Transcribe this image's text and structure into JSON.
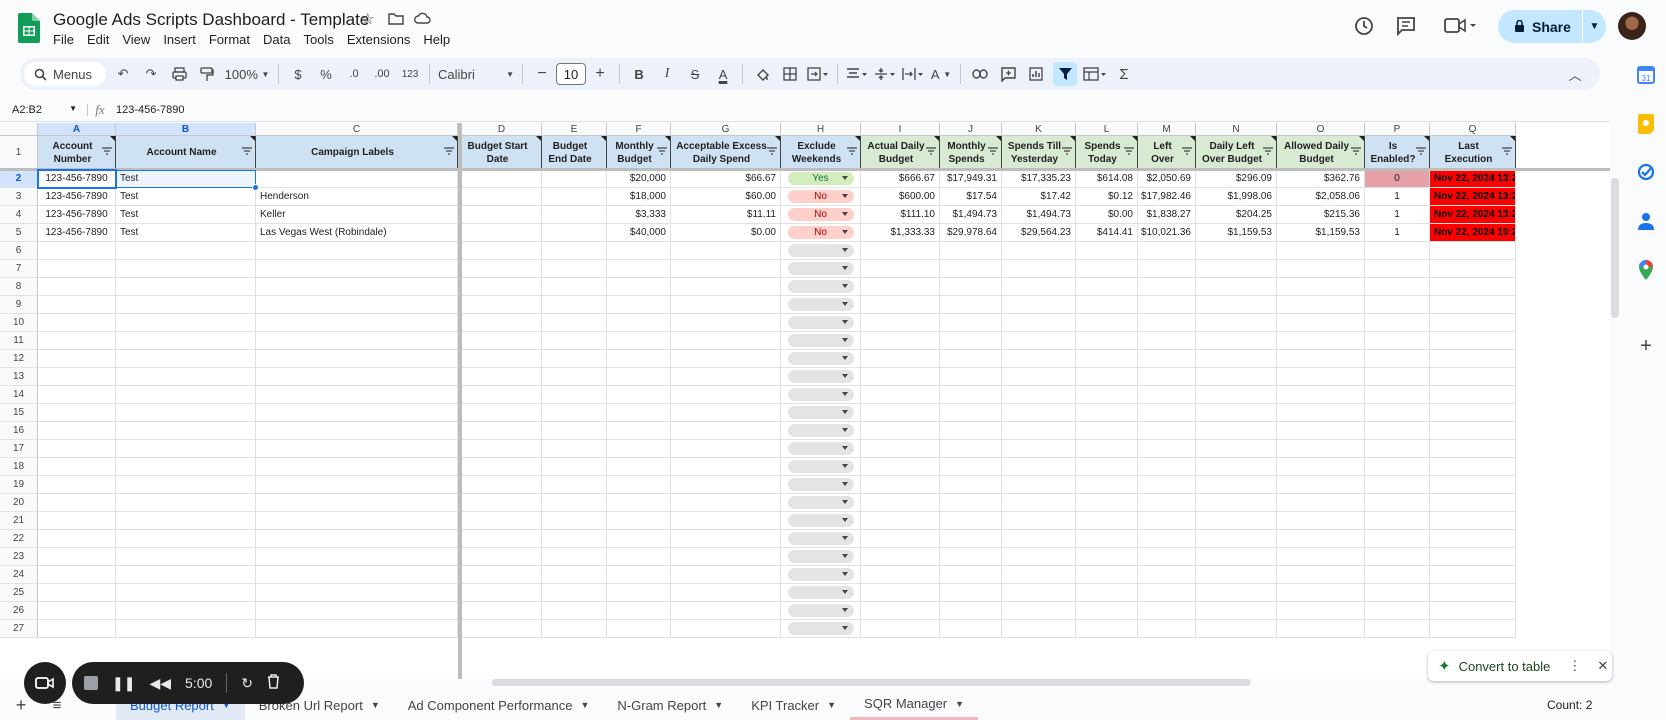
{
  "doc": {
    "title": "Google Ads Scripts Dashboard - Template",
    "menus": [
      "File",
      "Edit",
      "View",
      "Insert",
      "Format",
      "Data",
      "Tools",
      "Extensions",
      "Help"
    ],
    "share_label": "Share"
  },
  "toolbar": {
    "search_label": "Menus",
    "zoom": "100%",
    "currency": "$",
    "percent": "%",
    "dec_less": ".0",
    "dec_more": ".00",
    "number_format": "123",
    "font": "Calibri",
    "font_size": "10",
    "bold": "B",
    "italic": "I",
    "strike": "S",
    "text_color": "A",
    "text_rotation": "A",
    "sum": "Σ"
  },
  "formula_bar": {
    "name_box": "A2:B2",
    "fx": "fx",
    "content": "123-456-7890"
  },
  "colors": {
    "header_blue": "#cfe2f3",
    "header_green": "#d9ead3",
    "yes_chip": "#d4edbc",
    "no_chip": "#ffcfc9",
    "red_cell": "#ff0000",
    "pink_cell": "#e6a1a8",
    "accent": "#1a73e8"
  },
  "sheet": {
    "columns": [
      "A",
      "B",
      "C",
      "D",
      "E",
      "F",
      "G",
      "H",
      "I",
      "J",
      "K",
      "L",
      "M",
      "N",
      "O",
      "P",
      "Q"
    ],
    "headers": [
      "Account Number",
      "Account Name",
      "Campaign Labels",
      "Budget Start Date",
      "Budget End Date",
      "Monthly Budget",
      "Acceptable Excess Daily Spend",
      "Exclude Weekends",
      "Actual Daily Budget",
      "Monthly Spends",
      "Spends Till Yesterday",
      "Spends Today",
      "Left Over",
      "Daily Left Over Budget",
      "Allowed Daily Budget",
      "Is Enabled?",
      "Last Execution"
    ],
    "rows": [
      [
        "123-456-7890",
        "Test",
        "",
        "",
        "",
        "$20,000",
        "$66.67",
        "Yes",
        "$666.67",
        "$17,949.31",
        "$17,335.23",
        "$614.08",
        "$2,050.69",
        "$296.09",
        "$362.76",
        "0",
        "Nov 22, 2024 13:2"
      ],
      [
        "123-456-7890",
        "Test",
        "Henderson",
        "",
        "",
        "$18,000",
        "$60.00",
        "No",
        "$600.00",
        "$17.54",
        "$17.42",
        "$0.12",
        "$17,982.46",
        "$1,998.06",
        "$2,058.06",
        "1",
        "Nov 22, 2024 13:2"
      ],
      [
        "123-456-7890",
        "Test",
        "Keller",
        "",
        "",
        "$3,333",
        "$11.11",
        "No",
        "$111.10",
        "$1,494.73",
        "$1,494.73",
        "$0.00",
        "$1,838.27",
        "$204.25",
        "$215.36",
        "1",
        "Nov 22, 2024 13:2"
      ],
      [
        "123-456-7890",
        "Test",
        "Las Vegas West (Robindale)",
        "",
        "",
        "$40,000",
        "$0.00",
        "No",
        "$1,333.33",
        "$29,978.64",
        "$29,564.23",
        "$414.41",
        "$10,021.36",
        "$1,159.53",
        "$1,159.53",
        "1",
        "Nov 22, 2024 10:2"
      ]
    ],
    "row_numbers": [
      "1",
      "2",
      "3",
      "4",
      "5",
      "6",
      "7",
      "8",
      "9",
      "10",
      "11",
      "12",
      "13",
      "14",
      "15",
      "16",
      "17",
      "18",
      "19",
      "20",
      "21",
      "22",
      "23",
      "24",
      "25",
      "26",
      "27"
    ]
  },
  "tabs": [
    "Budget Report",
    "Broken Url Report",
    "Ad Component Performance",
    "N-Gram Report",
    "KPI Tracker",
    "SQR Manager"
  ],
  "status": {
    "count": "Count: 2"
  },
  "convert": {
    "label": "Convert to table"
  },
  "recorder": {
    "time": "5:00"
  }
}
